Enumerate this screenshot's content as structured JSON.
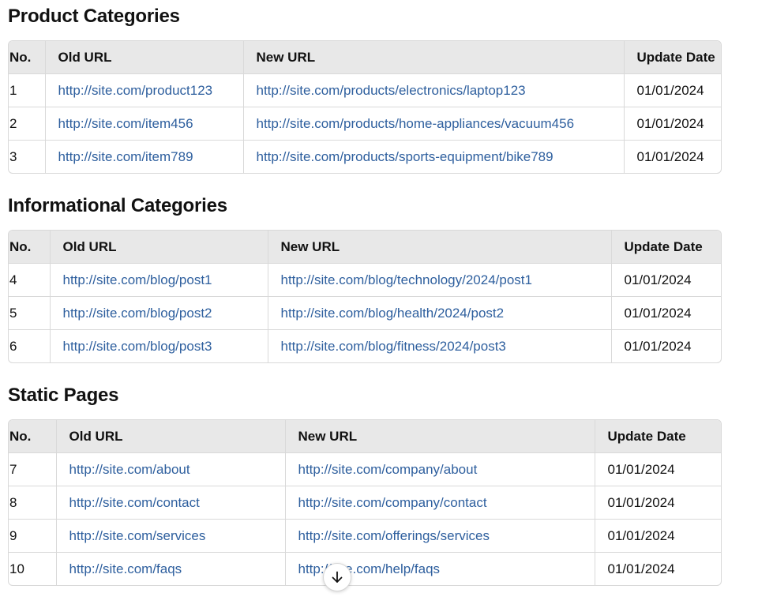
{
  "colors": {
    "link": "#2e5f9e",
    "header_bg": "#e8e8e8",
    "border": "#d9d9d9"
  },
  "headers": {
    "no": "No.",
    "old": "Old URL",
    "new": "New URL",
    "date": "Update Date"
  },
  "sections": [
    {
      "title": "Product Categories",
      "rows": [
        {
          "no": "1",
          "old": "http://site.com/product123",
          "new": "http://site.com/products/electronics/laptop123",
          "date": "01/01/2024"
        },
        {
          "no": "2",
          "old": "http://site.com/item456",
          "new": "http://site.com/products/home-appliances/vacuum456",
          "date": "01/01/2024"
        },
        {
          "no": "3",
          "old": "http://site.com/item789",
          "new": "http://site.com/products/sports-equipment/bike789",
          "date": "01/01/2024"
        }
      ]
    },
    {
      "title": "Informational Categories",
      "rows": [
        {
          "no": "4",
          "old": "http://site.com/blog/post1",
          "new": "http://site.com/blog/technology/2024/post1",
          "date": "01/01/2024"
        },
        {
          "no": "5",
          "old": "http://site.com/blog/post2",
          "new": "http://site.com/blog/health/2024/post2",
          "date": "01/01/2024"
        },
        {
          "no": "6",
          "old": "http://site.com/blog/post3",
          "new": "http://site.com/blog/fitness/2024/post3",
          "date": "01/01/2024"
        }
      ]
    },
    {
      "title": "Static Pages",
      "rows": [
        {
          "no": "7",
          "old": "http://site.com/about",
          "new": "http://site.com/company/about",
          "date": "01/01/2024"
        },
        {
          "no": "8",
          "old": "http://site.com/contact",
          "new": "http://site.com/company/contact",
          "date": "01/01/2024"
        },
        {
          "no": "9",
          "old": "http://site.com/services",
          "new": "http://site.com/offerings/services",
          "date": "01/01/2024"
        },
        {
          "no": "10",
          "old": "http://site.com/faqs",
          "new": "http://site.com/help/faqs",
          "date": "01/01/2024"
        }
      ]
    }
  ],
  "scroll_button": {
    "icon": "arrow-down-icon"
  }
}
